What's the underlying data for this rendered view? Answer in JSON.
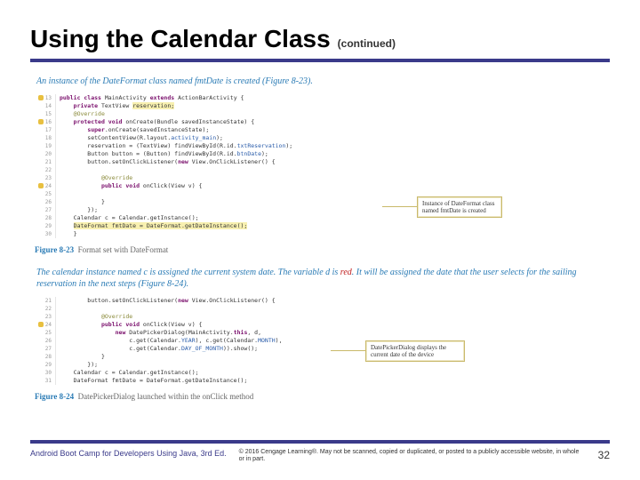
{
  "title": "Using the Calendar Class",
  "continued": "(continued)",
  "caption1": "An instance of the DateFormat class named fmtDate is created (Figure 8-23).",
  "code1": {
    "lines": [
      {
        "n": "13",
        "m": true,
        "html": "<span class='kw'>public class</span> MainActivity <span class='kw'>extends</span> ActionBarActivity {"
      },
      {
        "n": "14",
        "html": "    <span class='kw'>private</span> TextView <span class='hl'>reservation;</span>"
      },
      {
        "n": "15",
        "html": "    <span class='ann'>@Override</span>"
      },
      {
        "n": "16",
        "m": true,
        "html": "    <span class='kw'>protected void</span> onCreate(Bundle savedInstanceState) {"
      },
      {
        "n": "17",
        "html": "        <span class='kw'>super</span>.onCreate(savedInstanceState);"
      },
      {
        "n": "18",
        "html": "        setContentView(R.layout.<span class='str'>activity_main</span>);"
      },
      {
        "n": "19",
        "html": "        reservation = (TextView) findViewById(R.id.<span class='str'>txtReservation</span>);"
      },
      {
        "n": "20",
        "html": "        Button button = (Button) findViewById(R.id.<span class='str'>btnDate</span>);"
      },
      {
        "n": "21",
        "html": "        button.setOnClickListener(<span class='kw'>new</span> View.OnClickListener() {"
      },
      {
        "n": "22",
        "html": ""
      },
      {
        "n": "23",
        "html": "            <span class='ann'>@Override</span>"
      },
      {
        "n": "24",
        "m": true,
        "html": "            <span class='kw'>public void</span> onClick(View v) {"
      },
      {
        "n": "25",
        "html": ""
      },
      {
        "n": "26",
        "html": "            }"
      },
      {
        "n": "27",
        "html": "        });"
      },
      {
        "n": "28",
        "html": "    Calendar c = Calendar.getInstance();"
      },
      {
        "n": "29",
        "html": "    <span class='hl'>DateFormat fmtDate = DateFormat.getDateInstance();</span>"
      },
      {
        "n": "30",
        "html": "    }"
      }
    ]
  },
  "callout1": "Instance of DateFormat class named fmtDate is created",
  "fig1_no": "Figure 8-23",
  "fig1_txt": "Format set with DateFormat",
  "caption2_a": "The calendar instance named c is assigned the current system date. The variable d is",
  "caption2_red": "red",
  "caption2_b": ". It will be assigned the date that the user selects for the sailing reservation in the next steps (Figure 8-24).",
  "code2": {
    "lines": [
      {
        "n": "21",
        "html": "        button.setOnClickListener(<span class='kw'>new</span> View.OnClickListener() {"
      },
      {
        "n": "22",
        "html": ""
      },
      {
        "n": "23",
        "html": "            <span class='ann'>@Override</span>"
      },
      {
        "n": "24",
        "m": true,
        "html": "            <span class='kw'>public void</span> onClick(View v) {"
      },
      {
        "n": "25",
        "html": "                <span class='kw'>new</span> DatePickerDialog(MainActivity.<span class='kw'>this</span>, d,"
      },
      {
        "n": "26",
        "html": "                    c.get(Calendar.<span class='str'>YEAR</span>), c.get(Calendar.<span class='str'>MONTH</span>),"
      },
      {
        "n": "27",
        "html": "                    c.get(Calendar.<span class='str'>DAY_OF_MONTH</span>)).show();"
      },
      {
        "n": "28",
        "html": "            }"
      },
      {
        "n": "29",
        "html": "        });"
      },
      {
        "n": "30",
        "html": "    Calendar c = Calendar.getInstance();"
      },
      {
        "n": "31",
        "html": "    DateFormat fmtDate = DateFormat.getDateInstance();"
      }
    ]
  },
  "callout2": "DatePickerDialog displays the current date of the device",
  "fig2_no": "Figure 8-24",
  "fig2_txt": "DatePickerDialog launched within the onClick method",
  "footer_book": "Android Boot Camp for Developers Using Java, 3rd Ed.",
  "footer_copy": "© 2016 Cengage Learning®. May not be scanned, copied or duplicated, or posted to a publicly accessible website, in whole or in part.",
  "page_number": "32"
}
